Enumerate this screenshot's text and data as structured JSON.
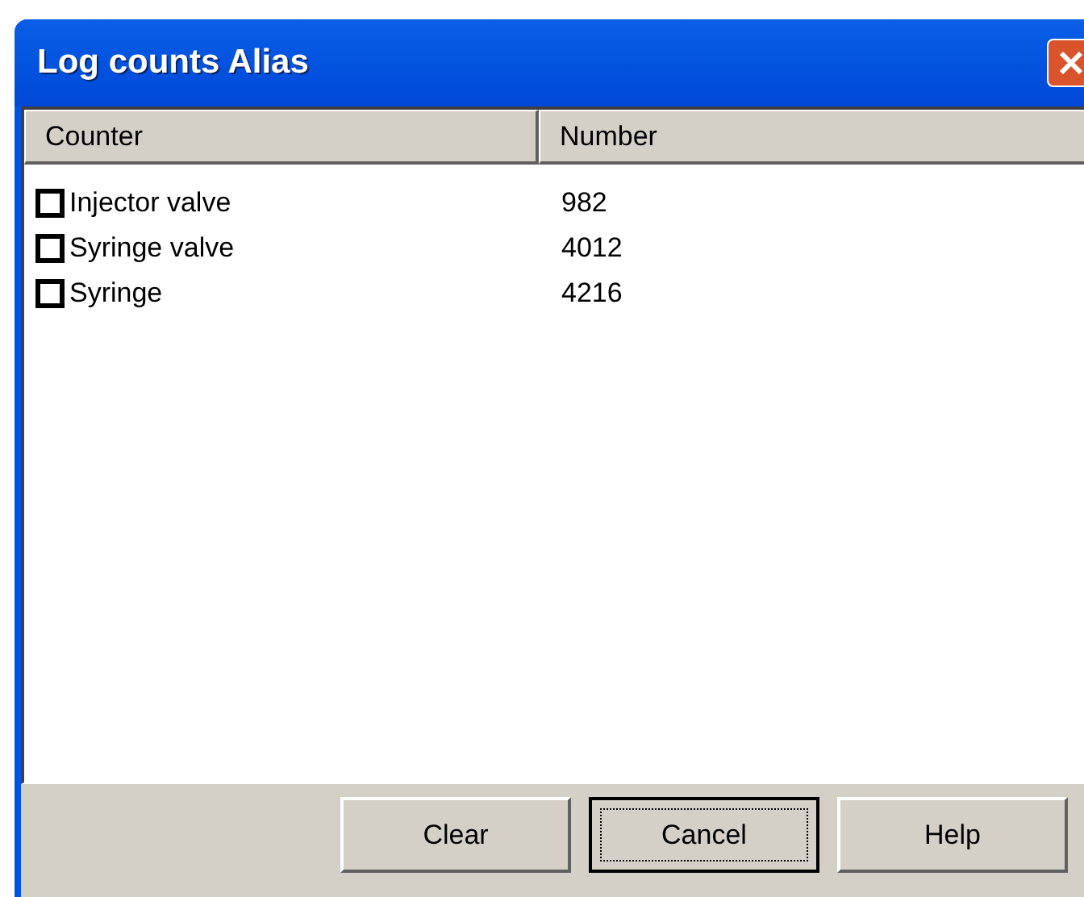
{
  "window": {
    "title": "Log counts Alias"
  },
  "table": {
    "columns": [
      "Counter",
      "Number"
    ],
    "rows": [
      {
        "counter": "Injector valve",
        "number": "982",
        "checked": false
      },
      {
        "counter": "Syringe valve",
        "number": "4012",
        "checked": false
      },
      {
        "counter": "Syringe",
        "number": "4216",
        "checked": false
      }
    ]
  },
  "buttons": [
    {
      "label": "Clear",
      "focused": false
    },
    {
      "label": "Cancel",
      "focused": true
    },
    {
      "label": "Help",
      "focused": false
    }
  ]
}
